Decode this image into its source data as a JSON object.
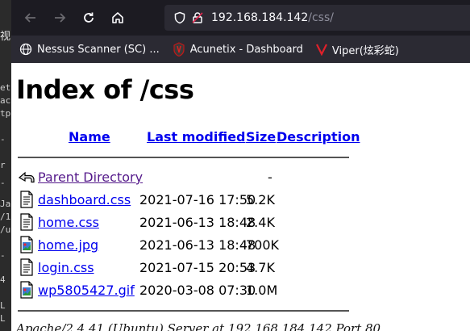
{
  "browser": {
    "url_host": "192.168.184.142",
    "url_path": "/css/"
  },
  "bookmarks": [
    {
      "label": "Nessus Scanner (SC) ...",
      "icon": "globe-icon"
    },
    {
      "label": "Acunetix - Dashboard",
      "icon": "acunetix-icon"
    },
    {
      "label": "Viper(炫彩蛇)",
      "icon": "viper-icon"
    }
  ],
  "page": {
    "title": "Index of /css",
    "columns": {
      "name": "Name",
      "last_modified": "Last modified",
      "size": "Size",
      "description": "Description"
    },
    "parent": {
      "name": "Parent Directory",
      "size": "-"
    },
    "files": [
      {
        "name": "dashboard.css",
        "modified": "2021-07-16 17:50",
        "size": "5.2K",
        "type": "text"
      },
      {
        "name": "home.css",
        "modified": "2021-06-13 18:48",
        "size": "2.4K",
        "type": "text"
      },
      {
        "name": "home.jpg",
        "modified": "2021-06-13 18:48",
        "size": "700K",
        "type": "image"
      },
      {
        "name": "login.css",
        "modified": "2021-07-15 20:53",
        "size": "4.7K",
        "type": "text"
      },
      {
        "name": "wp5805427.gif",
        "modified": "2020-03-08 07:30",
        "size": "1.0M",
        "type": "image"
      }
    ],
    "footer": "Apache/2.4.41 (Ubuntu) Server at 192.168.184.142 Port 80"
  },
  "terminal": {
    "lines": [
      "视",
      "et",
      "ac",
      "tp",
      "-",
      "r",
      "-",
      "Ja",
      "/1",
      "/u",
      "-",
      "4",
      "L",
      "L"
    ]
  }
}
